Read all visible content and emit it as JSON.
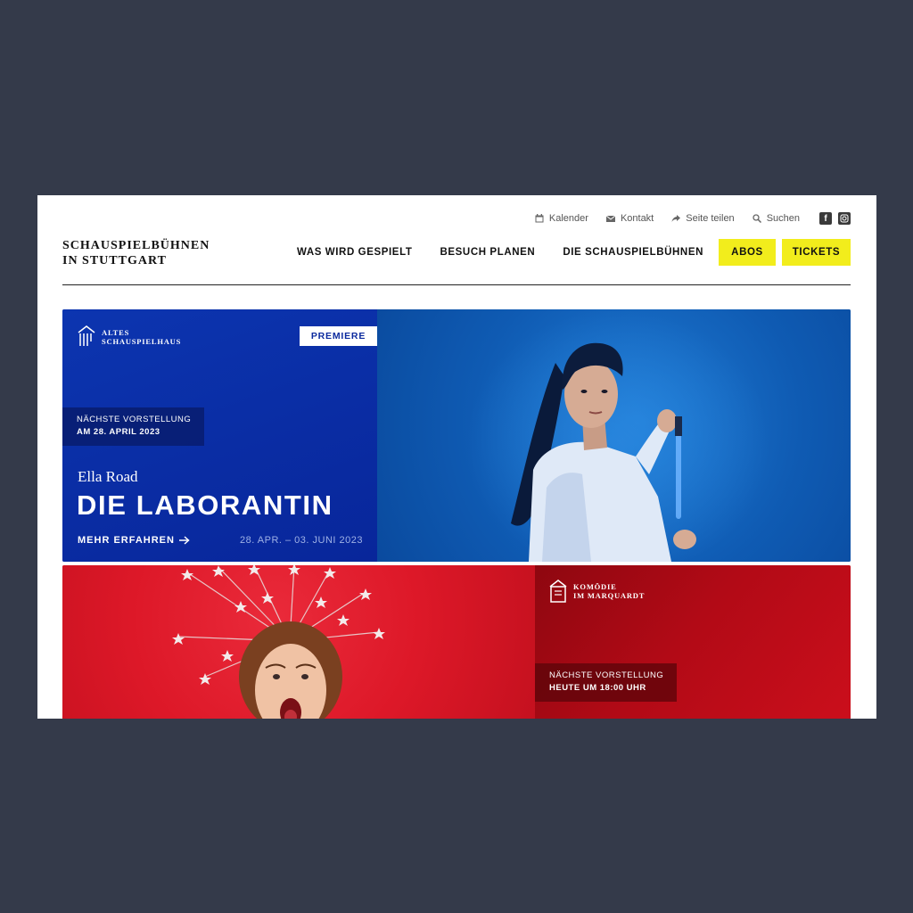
{
  "utility_nav": {
    "calendar": "Kalender",
    "contact": "Kontakt",
    "share": "Seite teilen",
    "search": "Suchen"
  },
  "logo": {
    "line1": "SCHAUSPIELBÜHNEN",
    "line2": "IN STUTTGART"
  },
  "main_nav": {
    "item1": "WAS WIRD GESPIELT",
    "item2": "BESUCH PLANEN",
    "item3": "DIE SCHAUSPIELBÜHNEN",
    "abos": "ABOS",
    "tickets": "TICKETS"
  },
  "colors": {
    "accent_yellow": "#f2ed1c",
    "card_blue": "#0a2ea8",
    "card_red": "#e01b2c",
    "background": "#343a4a"
  },
  "featured": [
    {
      "venue_line1": "ALTES",
      "venue_line2": "SCHAUSPIELHAUS",
      "badge": "PREMIERE",
      "next_label": "NÄCHSTE VORSTELLUNG",
      "next_date": "AM 28. APRIL 2023",
      "author": "Ella Road",
      "title": "DIE LABORANTIN",
      "more_link": "MEHR ERFAHREN",
      "date_range": "28. APR. – 03. JUNI 2023"
    },
    {
      "venue_line1": "KOMÖDIE",
      "venue_line2": "IM MARQUARDT",
      "next_label": "NÄCHSTE VORSTELLUNG",
      "next_date": "HEUTE UM 18:00 UHR"
    }
  ],
  "icons": {
    "calendar": "calendar-icon",
    "contact": "envelope-icon",
    "share": "share-icon",
    "search": "search-icon",
    "facebook": "facebook-icon",
    "instagram": "instagram-icon",
    "venue": "theater-building-icon",
    "arrow": "arrow-right-icon"
  }
}
